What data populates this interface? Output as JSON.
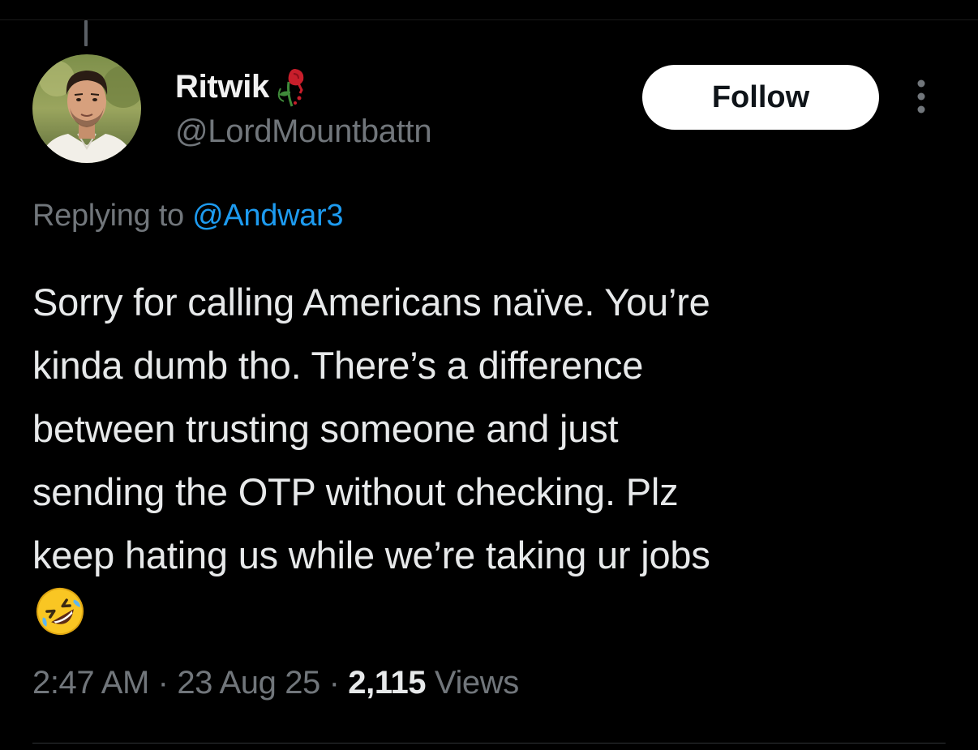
{
  "tweet": {
    "author": {
      "display_name": "Ritwik",
      "name_emoji_icon": "wilted-rose-icon",
      "handle": "@LordMountbattn",
      "avatar_icon": "profile-photo"
    },
    "follow_label": "Follow",
    "more_icon": "more-options-icon",
    "reply": {
      "prefix": "Replying to ",
      "mention": "@Andwar3"
    },
    "text_lines": [
      "Sorry for calling Americans naïve. You’re",
      "kinda dumb tho. There’s a difference",
      "between trusting someone and just",
      "sending the OTP without checking. Plz",
      "keep hating us while we’re taking ur jobs"
    ],
    "trailing_emoji_icon": "rolling-on-the-floor-laughing-icon",
    "meta": {
      "time": "2:47 AM",
      "sep1": " · ",
      "date": "23 Aug 25",
      "sep2": " · ",
      "views_count": "2,115",
      "views_label": " Views"
    }
  },
  "colors": {
    "background": "#000000",
    "primary_text": "#e7e9ea",
    "secondary_text": "#71767b",
    "link": "#1d9bf0",
    "follow_bg": "#ffffff",
    "follow_text": "#0f1419"
  }
}
